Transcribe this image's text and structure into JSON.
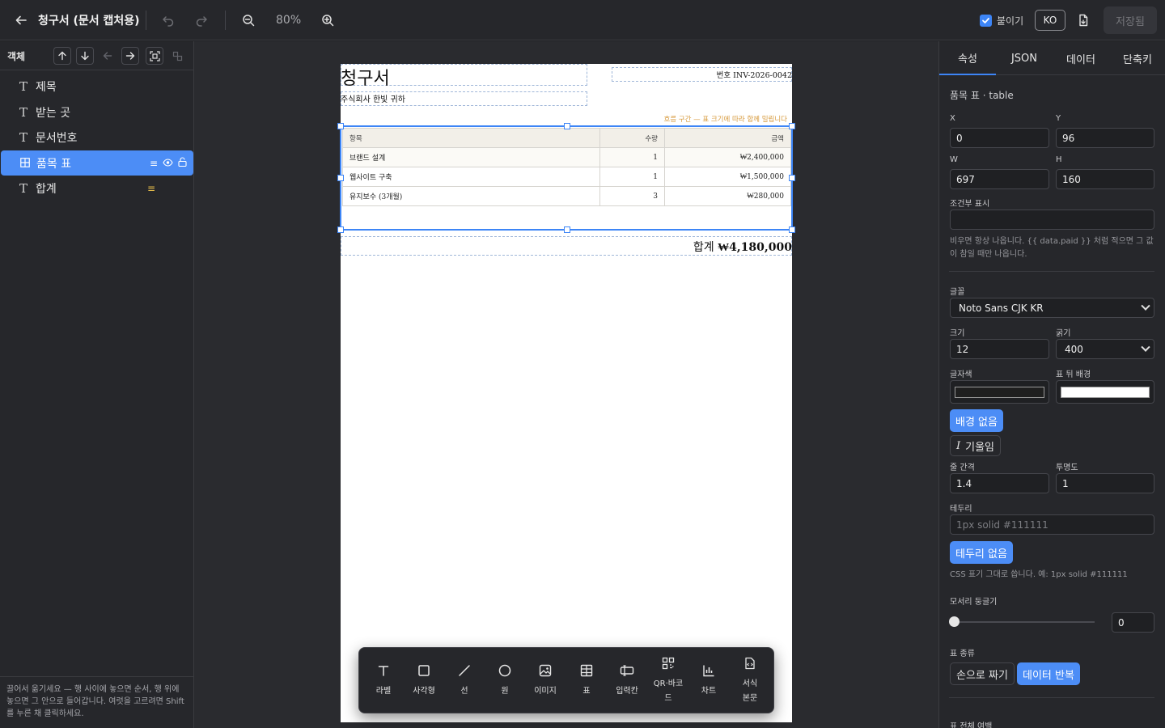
{
  "header": {
    "doc_title": "청구서 (문서 캡처용)",
    "zoom": "80%",
    "snap_label": "붙이기",
    "snap_checked": true,
    "lang": "KO",
    "saved_label": "저장됨"
  },
  "layers": {
    "title": "객체",
    "items": [
      {
        "label": "제목",
        "type": "text"
      },
      {
        "label": "받는 곳",
        "type": "text"
      },
      {
        "label": "문서번호",
        "type": "text"
      },
      {
        "label": "품목 표",
        "type": "table",
        "selected": true
      },
      {
        "label": "합계",
        "type": "text"
      }
    ],
    "footer_hint": "끌어서 옮기세요 — 행 사이에 놓으면 순서, 행 위에 놓으면 그 안으로 들어갑니다. 여럿을 고르려면 Shift를 누른 채 클릭하세요."
  },
  "document": {
    "title": "청구서",
    "recipient": "주식회사 한빛 귀하",
    "number": "번호 INV-2026-0042",
    "flow_note": "흐름 구간 — 표 크기에 따라 함께 밀립니다",
    "table": {
      "headers": [
        "항목",
        "수량",
        "금액"
      ],
      "rows": [
        [
          "브랜드 설계",
          "1",
          "₩2,400,000"
        ],
        [
          "웹사이트 구축",
          "1",
          "₩1,500,000"
        ],
        [
          "유지보수 (3개월)",
          "3",
          "₩280,000"
        ]
      ]
    },
    "total_label": "합계",
    "total_amount": "₩4,180,000"
  },
  "toolbar": {
    "tools": [
      {
        "label": "라벨",
        "icon": "text-icon"
      },
      {
        "label": "사각형",
        "icon": "square-icon"
      },
      {
        "label": "선",
        "icon": "line-icon"
      },
      {
        "label": "원",
        "icon": "circle-icon"
      },
      {
        "label": "이미지",
        "icon": "image-icon"
      },
      {
        "label": "표",
        "icon": "table-icon"
      },
      {
        "label": "입력칸",
        "icon": "input-icon"
      },
      {
        "label": "QR·바코드",
        "icon": "qr-icon"
      },
      {
        "label": "차트",
        "icon": "chart-icon"
      },
      {
        "label": "서식 본문",
        "icon": "doc-icon"
      }
    ]
  },
  "props": {
    "tabs": [
      "속성",
      "JSON",
      "데이터",
      "단축키"
    ],
    "active_tab": "속성",
    "object_name": "품목 표 · table",
    "x_label": "X",
    "x": "0",
    "y_label": "Y",
    "y": "96",
    "w_label": "W",
    "w": "697",
    "h_label": "H",
    "h": "160",
    "cond_label": "조건부 표시",
    "cond_value": "",
    "cond_help": "비우면 항상 나옵니다. {{ data.paid }} 처럼 적으면 그 값이 참일 때만 나옵니다.",
    "font_label": "글꼴",
    "font": "Noto Sans CJK KR",
    "size_label": "크기",
    "size": "12",
    "weight_label": "굵기",
    "weight": "400",
    "color_label": "글자색",
    "text_color": "#1f1f1f",
    "bg_label": "표 뒤 배경",
    "bg_color": "#ffffff",
    "no_bg_btn": "배경 없음",
    "italic_btn": "기울임",
    "line_height_label": "줄 간격",
    "line_height": "1.4",
    "opacity_label": "투명도",
    "opacity": "1",
    "border_label": "테두리",
    "border_placeholder": "1px solid #111111",
    "no_border_btn": "테두리 없음",
    "border_help": "CSS 표기 그대로 씁니다. 예: 1px solid #111111",
    "radius_label": "모서리 둥글기",
    "radius": "0",
    "radius_fraction": 0,
    "table_kind_label": "표 종류",
    "kind_manual": "손으로 짜기",
    "kind_repeat": "데이터 반복",
    "table_padding_label": "표 전체 여백"
  },
  "colors": {
    "accent": "#4c8df6",
    "flow_note": "#d79a3c"
  }
}
